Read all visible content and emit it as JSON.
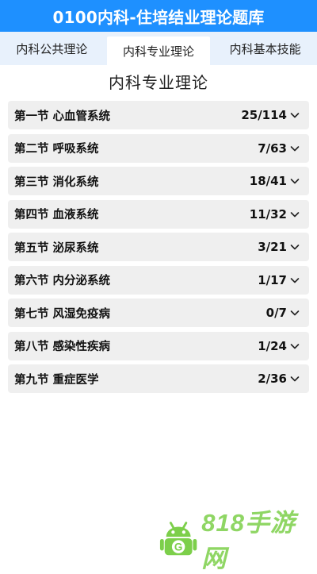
{
  "header": {
    "title": "0100内科-住培结业理论题库"
  },
  "tabs": [
    {
      "label": "内科公共理论",
      "active": false
    },
    {
      "label": "内科专业理论",
      "active": true
    },
    {
      "label": "内科基本技能",
      "active": false
    }
  ],
  "section": {
    "title": "内科专业理论"
  },
  "chapters": [
    {
      "label": "第一节 心血管系统",
      "count": "25/114"
    },
    {
      "label": "第二节 呼吸系统",
      "count": "7/63"
    },
    {
      "label": "第三节 消化系统",
      "count": "18/41"
    },
    {
      "label": "第四节 血液系统",
      "count": "11/32"
    },
    {
      "label": "第五节 泌尿系统",
      "count": "3/21"
    },
    {
      "label": "第六节 内分泌系统",
      "count": "1/17"
    },
    {
      "label": "第七节 风湿免疫病",
      "count": "0/7"
    },
    {
      "label": "第八节 感染性疾病",
      "count": "1/24"
    },
    {
      "label": "第九节 重症医学",
      "count": "2/36"
    }
  ],
  "watermark": {
    "text": "818手游网",
    "logo_letter": "G"
  },
  "colors": {
    "header_bg": "#1e90ff",
    "tabs_bg": "#e8f1fc",
    "row_bg": "#efefef",
    "watermark_green": "#7ccf4a"
  },
  "icons": {
    "row_chevron": "chevron-down-icon",
    "watermark_logo": "android-g-icon"
  }
}
